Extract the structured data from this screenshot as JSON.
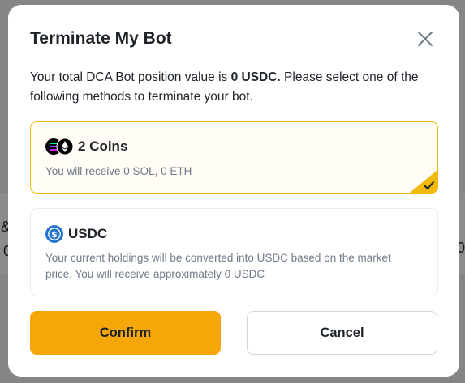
{
  "modal": {
    "title": "Terminate My Bot",
    "close_icon": "close-icon",
    "description_prefix": "Your total DCA Bot position value is ",
    "description_value": "0 USDC.",
    "description_suffix": " Please select one of the following methods to terminate your bot."
  },
  "options": [
    {
      "id": "coins",
      "label": "2 Coins",
      "icon": "coin-pair-icon",
      "subtitle": "You will receive 0 SOL, 0 ETH",
      "selected": true
    },
    {
      "id": "usdc",
      "label": "USDC",
      "icon": "usdc-icon",
      "subtitle": "Your current holdings will be converted into USDC based on the market price. You will receive approximately 0 USDC",
      "selected": false
    }
  ],
  "buttons": {
    "confirm_label": "Confirm",
    "cancel_label": "Cancel"
  },
  "background": {
    "fragment_1": "&",
    "fragment_2": "0",
    "fragment_3": "0"
  },
  "colors": {
    "accent": "#f0b90b",
    "confirm_bg": "#f5a70a",
    "usdc_blue": "#2775ca",
    "text_primary": "#1e2329",
    "text_secondary": "#707a8a"
  }
}
